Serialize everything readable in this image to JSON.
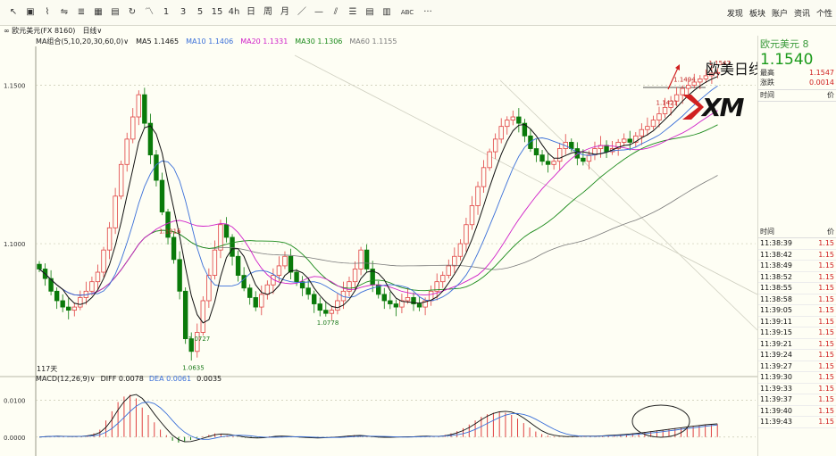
{
  "toolbar": {
    "icons": [
      "arrow-icon",
      "box-icon",
      "line-chart-icon",
      "compare-icon",
      "stack-icon",
      "grid-icon",
      "save-icon",
      "refresh-icon",
      "zigzag-icon"
    ],
    "periods": [
      "1",
      "3",
      "5",
      "15",
      "4h",
      "日",
      "周",
      "月"
    ],
    "tools": [
      "line-tool-icon",
      "hline-tool-icon",
      "parallel-tool-icon",
      "fib-tool-icon",
      "channel-tool-icon",
      "bars-tool-icon",
      "text-tool-icon",
      "more-icon"
    ],
    "tools_text": {
      "abc": "ABC",
      "more": "···"
    },
    "right_items": [
      "发现",
      "板块",
      "账户",
      "资讯",
      "个性"
    ]
  },
  "subbar": {
    "symbol": "∞ 欧元美元(FX 8160)",
    "period": "日线∨"
  },
  "legend": {
    "title": "MA组合(5,10,20,30,60,0)∨",
    "items": [
      {
        "label": "MA5 1.1465",
        "color": "#111111"
      },
      {
        "label": "MA10 1.1406",
        "color": "#3a6fd8"
      },
      {
        "label": "MA20 1.1331",
        "color": "#d020c8"
      },
      {
        "label": "MA30 1.1306",
        "color": "#1a8a1a"
      },
      {
        "label": "MA60 1.1155",
        "color": "#7a7a7a"
      }
    ]
  },
  "macd_legend": {
    "title": "MACD(12,26,9)∨",
    "items": [
      {
        "label": "DIFF 0.0078",
        "color": "#111111"
      },
      {
        "label": "DEA 0.0061",
        "color": "#3a6fd8"
      },
      {
        "label": "0.0035",
        "color": "#111111"
      }
    ]
  },
  "overlay": {
    "title": "欧美日线",
    "logo": "XM"
  },
  "days_label": "117天",
  "side": {
    "title": "欧元美元 8",
    "price": "1.1540",
    "rows": [
      {
        "label": "最高",
        "value": "1.1547"
      },
      {
        "label": "涨跌",
        "value": "0.0014"
      }
    ],
    "head": {
      "time": "时间",
      "price": "价"
    },
    "tick_head": {
      "time": "时间",
      "price": "价"
    },
    "ticks": [
      {
        "time": "11:38:39",
        "price": "1.15"
      },
      {
        "time": "11:38:42",
        "price": "1.15"
      },
      {
        "time": "11:38:49",
        "price": "1.15"
      },
      {
        "time": "11:38:52",
        "price": "1.15"
      },
      {
        "time": "11:38:55",
        "price": "1.15"
      },
      {
        "time": "11:38:58",
        "price": "1.15"
      },
      {
        "time": "11:39:05",
        "price": "1.15"
      },
      {
        "time": "11:39:11",
        "price": "1.15"
      },
      {
        "time": "11:39:15",
        "price": "1.15"
      },
      {
        "time": "11:39:21",
        "price": "1.15"
      },
      {
        "time": "11:39:24",
        "price": "1.15"
      },
      {
        "time": "11:39:27",
        "price": "1.15"
      },
      {
        "time": "11:39:30",
        "price": "1.15"
      },
      {
        "time": "11:39:33",
        "price": "1.15"
      },
      {
        "time": "11:39:37",
        "price": "1.15"
      },
      {
        "time": "11:39:40",
        "price": "1.15"
      },
      {
        "time": "11:39:43",
        "price": "1.15"
      }
    ]
  },
  "chart_data": {
    "type": "candlestick",
    "y_ticks": [
      "1.1500",
      "1.1000"
    ],
    "macd_y_ticks": [
      "0.0100",
      "0.0000"
    ],
    "annotations": [
      {
        "text": "1.1494",
        "value": 1.1494
      },
      {
        "text": "1.0778",
        "value": 1.0778
      },
      {
        "text": "1.0635",
        "value": 1.0635
      },
      {
        "text": "1.1016",
        "value": 1.1016
      },
      {
        "text": "1.0727",
        "value": 1.0727
      },
      {
        "text": "1.1421",
        "value": 1.1421
      },
      {
        "text": "1.1547",
        "value": 1.1547
      }
    ],
    "ylim": [
      1.062,
      1.16
    ],
    "macd_ylim": [
      -0.002,
      0.014
    ],
    "ma_colors": {
      "ma5": "#111111",
      "ma10": "#3a6fd8",
      "ma20": "#d020c8",
      "ma30": "#1a8a1a",
      "ma60": "#7a7a7a"
    },
    "up_color": "#e04040",
    "down_color": "#0a7a0a",
    "candle_count": 117,
    "price_path": [
      1.092,
      1.089,
      1.085,
      1.082,
      1.08,
      1.079,
      1.08,
      1.083,
      1.085,
      1.088,
      1.091,
      1.098,
      1.105,
      1.115,
      1.125,
      1.133,
      1.14,
      1.147,
      1.138,
      1.128,
      1.12,
      1.11,
      1.102,
      1.095,
      1.085,
      1.07,
      1.066,
      1.072,
      1.082,
      1.09,
      1.098,
      1.106,
      1.102,
      1.096,
      1.09,
      1.086,
      1.083,
      1.08,
      1.084,
      1.087,
      1.09,
      1.093,
      1.096,
      1.091,
      1.088,
      1.086,
      1.084,
      1.081,
      1.079,
      1.078,
      1.079,
      1.082,
      1.085,
      1.088,
      1.092,
      1.098,
      1.092,
      1.087,
      1.084,
      1.082,
      1.081,
      1.08,
      1.082,
      1.083,
      1.081,
      1.08,
      1.082,
      1.085,
      1.088,
      1.09,
      1.093,
      1.096,
      1.1,
      1.106,
      1.112,
      1.118,
      1.124,
      1.129,
      1.133,
      1.137,
      1.139,
      1.14,
      1.138,
      1.134,
      1.13,
      1.128,
      1.126,
      1.125,
      1.126,
      1.13,
      1.132,
      1.13,
      1.127,
      1.126,
      1.128,
      1.13,
      1.131,
      1.129,
      1.13,
      1.132,
      1.133,
      1.132,
      1.134,
      1.136,
      1.137,
      1.139,
      1.141,
      1.143,
      1.145,
      1.147,
      1.149,
      1.15,
      1.151,
      1.152,
      1.153,
      1.1538,
      1.154
    ],
    "macd_hist": [
      0.0,
      0.0002,
      0.0003,
      0.0002,
      0.0001,
      0.0001,
      0.0002,
      0.0003,
      0.0005,
      0.001,
      0.002,
      0.0045,
      0.007,
      0.0095,
      0.011,
      0.0115,
      0.0105,
      0.008,
      0.006,
      0.004,
      0.002,
      0.0005,
      -0.001,
      -0.0015,
      -0.0012,
      -0.0008,
      -0.0004,
      0.0002,
      0.0006,
      0.001,
      0.0008,
      0.0005,
      0.0002,
      0.0,
      -0.0002,
      -0.0003,
      -0.0002,
      0.0,
      0.0002,
      0.0003,
      0.0002,
      0.0001,
      0.0,
      -0.0001,
      -0.0002,
      -0.0003,
      -0.0002,
      -0.0001,
      0.0,
      0.0001,
      0.0002,
      0.0004,
      0.0005,
      0.0003,
      0.0001,
      0.0,
      -0.0001,
      -0.0001,
      0.0,
      0.0001,
      0.0,
      0.0001,
      0.0002,
      0.0003,
      0.0002,
      0.0001,
      0.0003,
      0.0006,
      0.001,
      0.0016,
      0.0024,
      0.0034,
      0.0045,
      0.0055,
      0.0062,
      0.0066,
      0.0068,
      0.0066,
      0.006,
      0.005,
      0.0038,
      0.0026,
      0.0015,
      0.0008,
      0.0004,
      0.0002,
      0.0001,
      0.0001,
      0.0002,
      0.0003,
      0.0002,
      0.0002,
      0.0003,
      0.0004,
      0.0005,
      0.0006,
      0.0007,
      0.0008,
      0.001,
      0.0012,
      0.0014,
      0.0016,
      0.0018,
      0.002,
      0.0022,
      0.0024,
      0.0026,
      0.0028,
      0.003,
      0.0032,
      0.0033,
      0.0034,
      0.0035
    ]
  }
}
